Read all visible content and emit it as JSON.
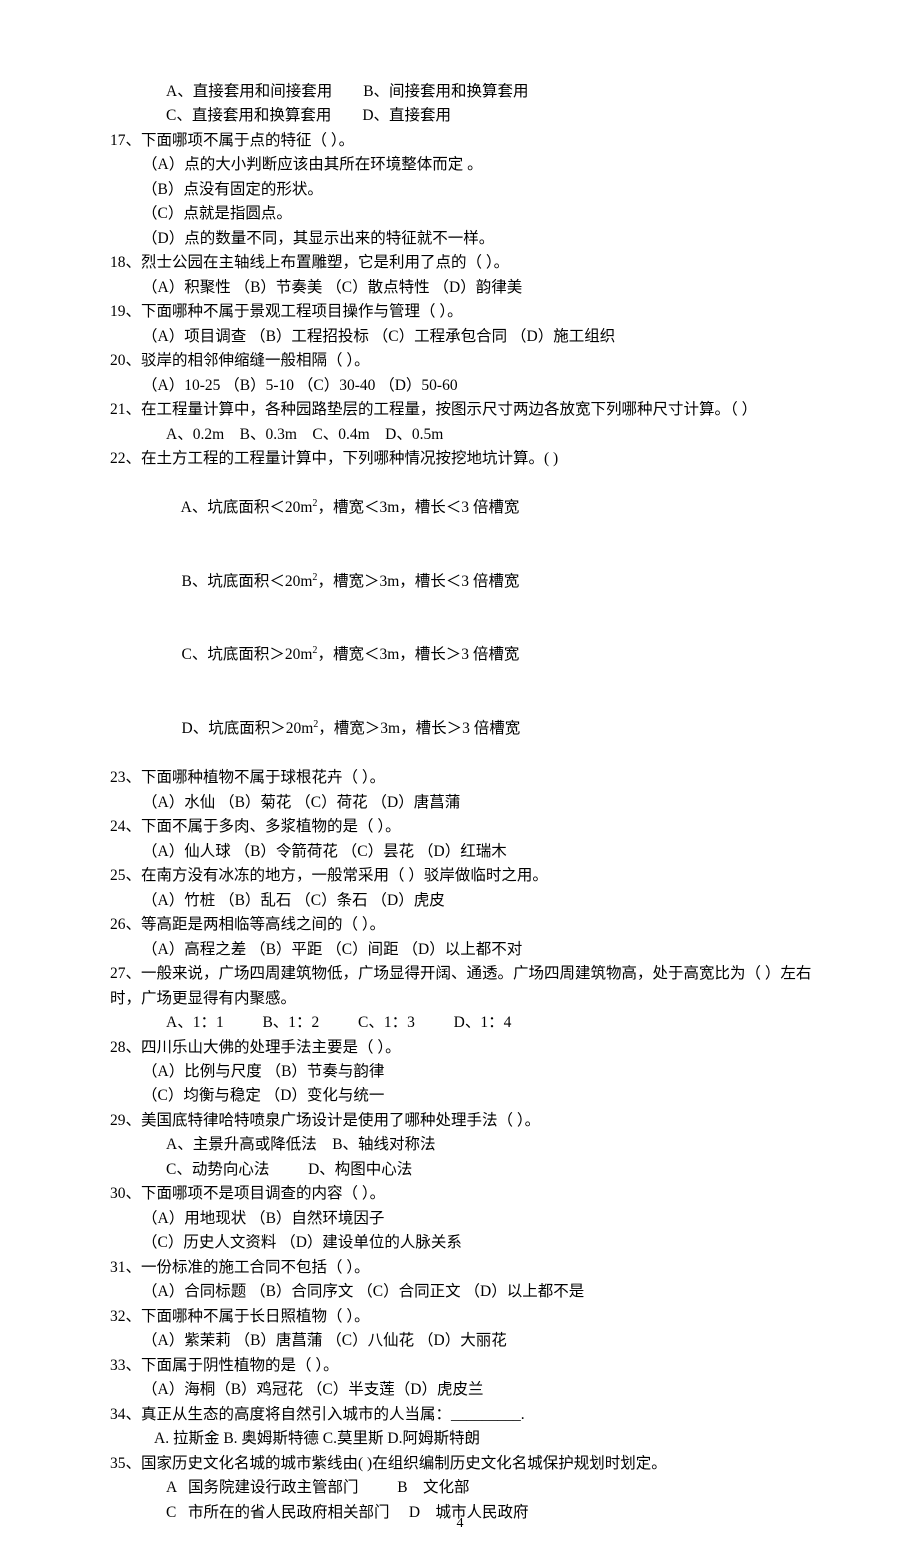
{
  "opt16a": "A、直接套用和间接套用        B、间接套用和换算套用",
  "opt16b": "C、直接套用和换算套用        D、直接套用",
  "q17": "17、下面哪项不属于点的特征（      ）。",
  "q17a": "（A）点的大小判断应该由其所在环境整体而定 。",
  "q17b": "（B）点没有固定的形状。",
  "q17c": "（C）点就是指圆点。",
  "q17d": "（D）点的数量不同，其显示出来的特征就不一样。",
  "q18": "18、烈士公园在主轴线上布置雕塑，它是利用了点的（     ）。",
  "q18o": "（A）积聚性   （B）节奏美   （C）散点特性    （D）韵律美",
  "q19": "19、下面哪种不属于景观工程项目操作与管理（      ）。",
  "q19o": "（A）项目调查   （B）工程招投标   （C）工程承包合同   （D）施工组织",
  "q20": "20、驳岸的相邻伸缩缝一般相隔（     ）。",
  "q20o": "（A）10-25       （B）5-10       （C）30-40      （D）50-60",
  "q21": "21、在工程量计算中，各种园路垫层的工程量，按图示尺寸两边各放宽下列哪种尺寸计算。（    ）",
  "q21o": "A、0.2m    B、0.3m    C、0.4m    D、0.5m",
  "q22": "22、在土方工程的工程量计算中，下列哪种情况按挖地坑计算。(    )",
  "q22a_pre": "A、坑底面积＜20m",
  "q22a_post": "，槽宽＜3m，槽长＜3 倍槽宽",
  "q22b_pre": "B、坑底面积＜20m",
  "q22b_post": "，槽宽＞3m，槽长＜3 倍槽宽",
  "q22c_pre": "C、坑底面积＞20m",
  "q22c_post": "，槽宽＜3m，槽长＞3 倍槽宽",
  "q22d_pre": "D、坑底面积＞20m",
  "q22d_post": "，槽宽＞3m，槽长＞3 倍槽宽",
  "sup2": "2",
  "q23": "23、下面哪种植物不属于球根花卉（      ）。",
  "q23o": "（A）水仙   （B）菊花   （C）荷花     （D）唐菖蒲",
  "q24": "24、下面不属于多肉、多浆植物的是（       ）。",
  "q24o": "（A）仙人球   （B）令箭荷花   （C）昙花   （D）红瑞木",
  "q25": "25、在南方没有冰冻的地方，一般常采用（       ）驳岸做临时之用。",
  "q25o": "（A）竹桩   （B）乱石   （C）条石     （D）虎皮",
  "q26": "26、等高距是两相临等高线之间的（     ）。",
  "q26o": "（A）高程之差    （B）平距   （C）间距    （D）以上都不对",
  "q27": "27、一般来说，广场四周建筑物低，广场显得开阔、通透。广场四周建筑物高，处于高宽比为（     ）左右时，广场更显得有内聚感。",
  "q27o": "A、1：1          B、1：2          C、1：3          D、1：4",
  "q28": "28、四川乐山大佛的处理手法主要是（     ）。",
  "q28a": "（A）比例与尺度           （B）节奏与韵律",
  "q28b": "（C）均衡与稳定           （D）变化与统一",
  "q29": "29、美国底特律哈特喷泉广场设计是使用了哪种处理手法（     ）。",
  "q29a": "A、主景升高或降低法    B、轴线对称法",
  "q29b": "C、动势向心法          D、构图中心法",
  "q30": "30、下面哪项不是项目调查的内容（     ）。",
  "q30a": "（A）用地现状             （B）自然环境因子",
  "q30b": "（C）历史人文资料         （D）建设单位的人脉关系",
  "q31": "31、一份标准的施工合同不包括（     ）。",
  "q31o": "（A）合同标题  （B）合同序文   （C）合同正文   （D）以上都不是",
  "q32": "32、下面哪种不属于长日照植物（      ）。",
  "q32o": "（A）紫茉莉    （B）唐菖蒲  （C）八仙花    （D）大丽花",
  "q33": "33、下面属于阴性植物的是（    ）。",
  "q33o": "（A）海桐（B）鸡冠花   （C）半支莲（D）虎皮兰",
  "q34": "34、真正从生态的高度将自然引入城市的人当属：_________.",
  "q34o": "A. 拉斯金       B. 奥姆斯特德         C.莫里斯         D.阿姆斯特朗",
  "q35": "35、国家历史文化名城的城市紫线由(    )在组织编制历史文化名城保护规划时划定。",
  "q35a": "A   国务院建设行政主管部门          B    文化部",
  "q35b": "C   市所在的省人民政府相关部门     D    城市人民政府",
  "pageNumber": "4"
}
